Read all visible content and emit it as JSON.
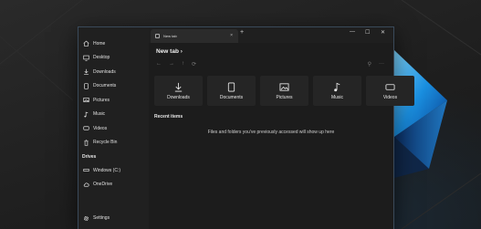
{
  "sidebar": {
    "items": [
      {
        "label": "Home",
        "icon": "home-icon"
      },
      {
        "label": "Desktop",
        "icon": "desktop-icon"
      },
      {
        "label": "Downloads",
        "icon": "download-icon"
      },
      {
        "label": "Documents",
        "icon": "document-icon"
      },
      {
        "label": "Pictures",
        "icon": "picture-icon"
      },
      {
        "label": "Music",
        "icon": "music-icon"
      },
      {
        "label": "Videos",
        "icon": "video-icon"
      },
      {
        "label": "Recycle Bin",
        "icon": "recycle-bin-icon"
      }
    ],
    "drives_heading": "Drives",
    "drives": [
      {
        "label": "Windows (C:)",
        "icon": "drive-icon"
      },
      {
        "label": "OneDrive",
        "icon": "cloud-icon"
      }
    ],
    "settings_label": "Settings"
  },
  "tabbar": {
    "tab_label": "New tab",
    "close_glyph": "×",
    "new_tab_glyph": "+",
    "minimize_glyph": "—",
    "maximize_glyph": "☐",
    "close_window_glyph": "✕"
  },
  "main": {
    "breadcrumb": "New tab  ›",
    "nav": {
      "back": "←",
      "forward": "→",
      "up": "↑",
      "refresh": "⟳"
    },
    "tools": {
      "search": "⚲",
      "more": "···"
    },
    "tiles": [
      {
        "label": "Downloads",
        "icon": "download-icon"
      },
      {
        "label": "Documents",
        "icon": "document-icon"
      },
      {
        "label": "Pictures",
        "icon": "picture-icon"
      },
      {
        "label": "Music",
        "icon": "music-icon"
      },
      {
        "label": "Videos",
        "icon": "video-icon"
      }
    ],
    "recent_heading": "Recent items",
    "empty_message": "Files and folders you've previously accessed will show up here"
  },
  "colors": {
    "accent": "#2ea3e8",
    "window_border": "#3a4a5a"
  }
}
